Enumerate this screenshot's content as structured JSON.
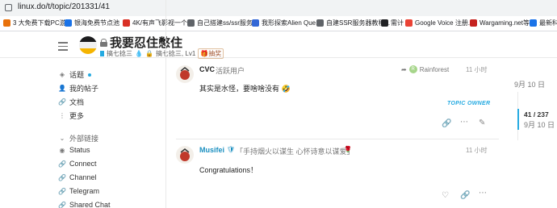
{
  "browser": {
    "url": "linux.do/t/topic/201331/41",
    "bookmarks": [
      {
        "label": "3 大免费下载PC游...",
        "color": "#e8710a"
      },
      {
        "label": "银海免费节点池",
        "color": "#1a73e8"
      },
      {
        "label": "4K/有声飞影视一个...",
        "color": "#d93025"
      },
      {
        "label": "自己搭建ss/ssr服务...",
        "color": "#5f6368"
      },
      {
        "label": "我形探索Alien Que...",
        "color": "#3367d6"
      },
      {
        "label": "自建SSR服务器教程...",
        "color": "#5f6368"
      },
      {
        "label": "需计",
        "color": "#202124"
      },
      {
        "label": "Google Voice 注册...",
        "color": "#ea4335"
      },
      {
        "label": "Wargaming.net等...",
        "color": "#c5221f"
      },
      {
        "label": "最新科",
        "color": "#1a73e8"
      }
    ]
  },
  "header": {
    "title": "我要忍住憋住",
    "crumb_category": "搞七捻三",
    "crumb_subcategory": "搞七捻三, Lv1",
    "tag": "抽奖",
    "brand_colors": [
      "#1c1c1e",
      "#f0f0f0",
      "#f5b400"
    ]
  },
  "sidebar": {
    "items": [
      {
        "label": "话题",
        "icon": "layers-icon"
      },
      {
        "label": "我的帖子",
        "icon": "user-icon"
      },
      {
        "label": "文档",
        "icon": "link-icon"
      },
      {
        "label": "更多",
        "icon": "more-icon"
      }
    ],
    "section_title": "外部链接",
    "links": [
      {
        "label": "Status",
        "icon": "eye-icon"
      },
      {
        "label": "Connect",
        "icon": "link-icon"
      },
      {
        "label": "Channel",
        "icon": "link-icon"
      },
      {
        "label": "Telegram",
        "icon": "link-icon"
      },
      {
        "label": "Shared Chat",
        "icon": "link-icon"
      }
    ]
  },
  "posts": [
    {
      "username": "CVC",
      "user_title": "活跃用户",
      "reply_to": "Rainforest",
      "reply_avatar_letter": "R",
      "time": "11 小时",
      "body": "其实是水怪，要啥啥没有 🤣",
      "badge": "TOPIC OWNER"
    },
    {
      "username": "Musifei",
      "user_title": "「手持烟火以谋生 心怀诗意以谋爱」",
      "time": "11 小时",
      "body": "Congratulations！"
    }
  ],
  "timeline": {
    "date_top": "9月 10 日",
    "position": "41 / 237",
    "date_current": "9月 10 日"
  }
}
